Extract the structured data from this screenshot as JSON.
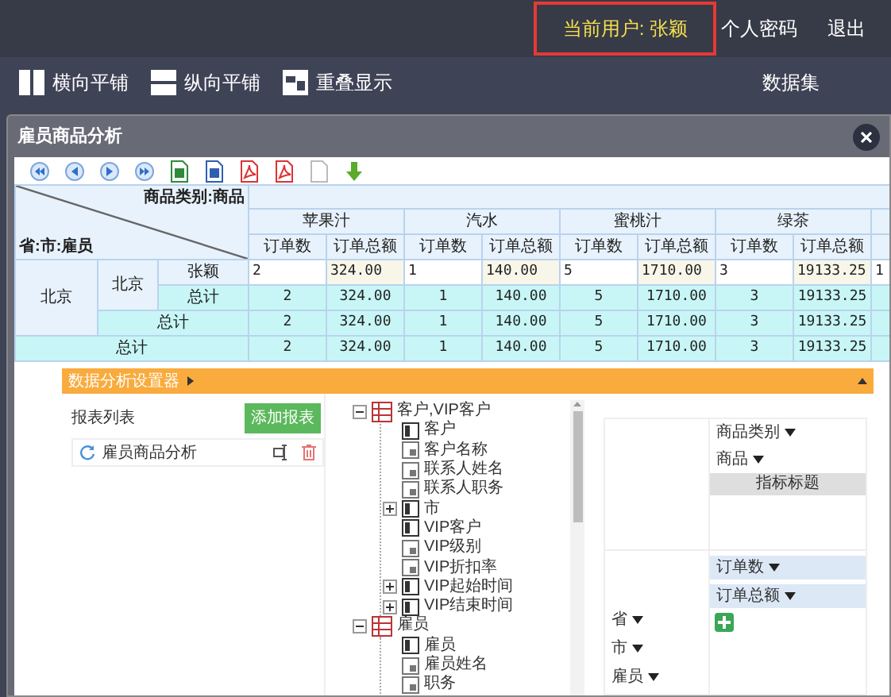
{
  "topbar": {
    "user_label": "当前用户: 张颖",
    "links": [
      "个人密码",
      "退出"
    ]
  },
  "toolbar": {
    "buttons": [
      {
        "label": "横向平铺",
        "kind": "columns"
      },
      {
        "label": "纵向平铺",
        "kind": "rows"
      },
      {
        "label": "重叠显示",
        "kind": "cascade"
      }
    ],
    "right_label": "数据集"
  },
  "window": {
    "title": "雇员商品分析",
    "tools": [
      {
        "kind": "first"
      },
      {
        "kind": "prev"
      },
      {
        "kind": "next"
      },
      {
        "kind": "last"
      },
      {
        "kind": "excel"
      },
      {
        "kind": "word"
      },
      {
        "kind": "pdf"
      },
      {
        "kind": "pdf"
      },
      {
        "kind": "blank"
      },
      {
        "kind": "download"
      }
    ]
  },
  "table": {
    "corner_top": "商品类别:商品",
    "corner_bottom": "省:市:雇员",
    "products": [
      {
        "name": "苹果汁",
        "metrics": [
          "订单数",
          "订单总额"
        ]
      },
      {
        "name": "汽水",
        "metrics": [
          "订单数",
          "订单总额"
        ]
      },
      {
        "name": "蜜桃汁",
        "metrics": [
          "订单数",
          "订单总额"
        ]
      },
      {
        "name": "绿茶",
        "metrics": [
          "订单数",
          "订单总额"
        ]
      }
    ],
    "province": "北京",
    "city": "北京",
    "rows": [
      {
        "kind": "detail",
        "label": "张颖",
        "values": [
          "2",
          "324.00",
          "1",
          "140.00",
          "5",
          "1710.00",
          "3",
          "19133.25",
          "1"
        ]
      },
      {
        "kind": "employee_total",
        "label": "总计",
        "values": [
          "2",
          "324.00",
          "1",
          "140.00",
          "5",
          "1710.00",
          "3",
          "19133.25"
        ]
      },
      {
        "kind": "city_total",
        "label": "总计",
        "values": [
          "2",
          "324.00",
          "1",
          "140.00",
          "5",
          "1710.00",
          "3",
          "19133.25"
        ]
      },
      {
        "kind": "grand_total",
        "label": "总计",
        "values": [
          "2",
          "324.00",
          "1",
          "140.00",
          "5",
          "1710.00",
          "3",
          "19133.25"
        ]
      }
    ]
  },
  "settings": {
    "title": "数据分析设置器",
    "report_list": {
      "title": "报表列表",
      "add_button": "添加报表",
      "items": [
        "雇员商品分析"
      ]
    },
    "tree": [
      {
        "label": "客户,VIP客户",
        "kind": "table",
        "expanded": true,
        "children": [
          {
            "label": "客户",
            "kind": "dimension"
          },
          {
            "label": "客户名称",
            "kind": "attribute"
          },
          {
            "label": "联系人姓名",
            "kind": "attribute"
          },
          {
            "label": "联系人职务",
            "kind": "attribute"
          },
          {
            "label": "市",
            "kind": "dimension",
            "expanded": false
          },
          {
            "label": "VIP客户",
            "kind": "dimension"
          },
          {
            "label": "VIP级别",
            "kind": "attribute"
          },
          {
            "label": "VIP折扣率",
            "kind": "attribute"
          },
          {
            "label": "VIP起始时间",
            "kind": "dimension",
            "expanded": false
          },
          {
            "label": "VIP结束时间",
            "kind": "dimension",
            "expanded": false
          }
        ]
      },
      {
        "label": "雇员",
        "kind": "table",
        "expanded": true,
        "children": [
          {
            "label": "雇员",
            "kind": "dimension"
          },
          {
            "label": "雇员姓名",
            "kind": "attribute"
          },
          {
            "label": "职务",
            "kind": "attribute"
          }
        ]
      }
    ],
    "layout": {
      "column_fields": [
        "商品类别",
        "商品"
      ],
      "measure_header": "指标标题",
      "measures": [
        "订单数",
        "订单总额"
      ],
      "row_fields": [
        "省",
        "市",
        "雇员"
      ]
    }
  }
}
